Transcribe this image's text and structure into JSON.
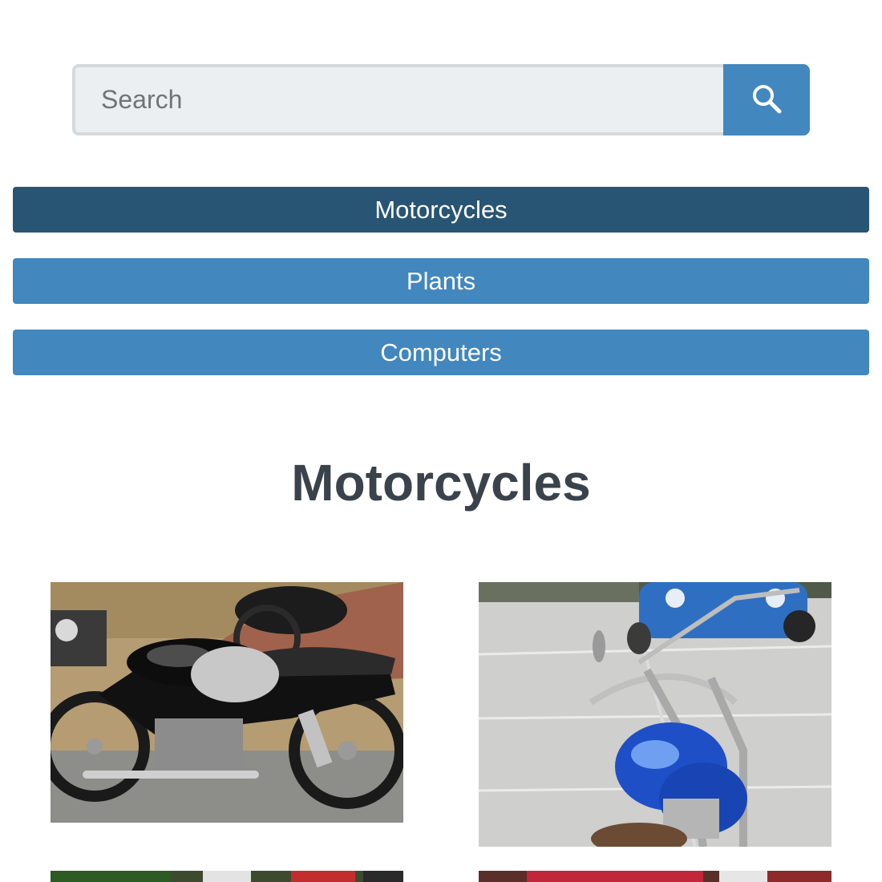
{
  "search": {
    "placeholder": "Search",
    "button_icon": "search-icon"
  },
  "categories": [
    {
      "label": "Motorcycles",
      "active": true
    },
    {
      "label": "Plants",
      "active": false
    },
    {
      "label": "Computers",
      "active": false
    }
  ],
  "section": {
    "title": "Motorcycles"
  },
  "gallery": [
    {
      "subject": "black cafe racer motorcycle"
    },
    {
      "subject": "blue chopper motorcycle"
    },
    {
      "subject": "motorcycle photo"
    },
    {
      "subject": "motorcycle photo"
    }
  ],
  "colors": {
    "primary": "#4287be",
    "active": "#285573",
    "heading": "#3a424b",
    "input_bg": "#eceff1"
  }
}
